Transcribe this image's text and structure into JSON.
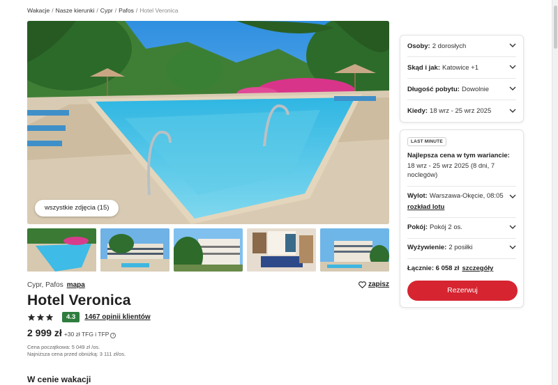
{
  "breadcrumb": {
    "items": [
      "Wakacje",
      "Nasze kierunki",
      "Cypr",
      "Pafos"
    ],
    "current": "Hotel Veronica"
  },
  "gallery": {
    "all_photos_label": "wszystkie zdjęcia (15)"
  },
  "hotel": {
    "location": "Cypr, Pafos",
    "map_label": "mapa",
    "save_label": "zapisz",
    "name": "Hotel Veronica",
    "stars": 3,
    "score": "4.3",
    "reviews": "1467 opinii klientów"
  },
  "price": {
    "main": "2 999 zł",
    "extra": "+30 zł TFG i TFP",
    "base_note": "Cena początkowa: 5 049 zł /os.",
    "lowest_note": "Najniższa cena przed obniżką: 3 111 zł/os."
  },
  "section": {
    "title": "W cenie wakacji"
  },
  "filters": [
    {
      "label": "Osoby:",
      "value": "2 dorosłych"
    },
    {
      "label": "Skąd i jak:",
      "value": "Katowice +1"
    },
    {
      "label": "Długość pobytu:",
      "value": "Dowolnie"
    },
    {
      "label": "Kiedy:",
      "value": "18 wrz - 25 wrz 2025"
    }
  ],
  "offer": {
    "badge": "LAST MINUTE",
    "best_title": "Najlepsza cena w tym wariancie:",
    "best_dates": "18 wrz - 25 wrz 2025 (8 dni, 7 noclegów)",
    "flight_label": "Wylot:",
    "flight_value": "Warszawa-Okęcie, 08:05",
    "flight_link": "rozkład lotu",
    "room_label": "Pokój:",
    "room_value": "Pokój 2 os.",
    "board_label": "Wyżywienie:",
    "board_value": "2 posiłki",
    "total_label": "Łącznie: 6 058 zł",
    "details_label": "szczegóły",
    "book_label": "Rezerwuj"
  },
  "colors": {
    "accent": "#d62430",
    "score_bg": "#2e7d3e"
  }
}
